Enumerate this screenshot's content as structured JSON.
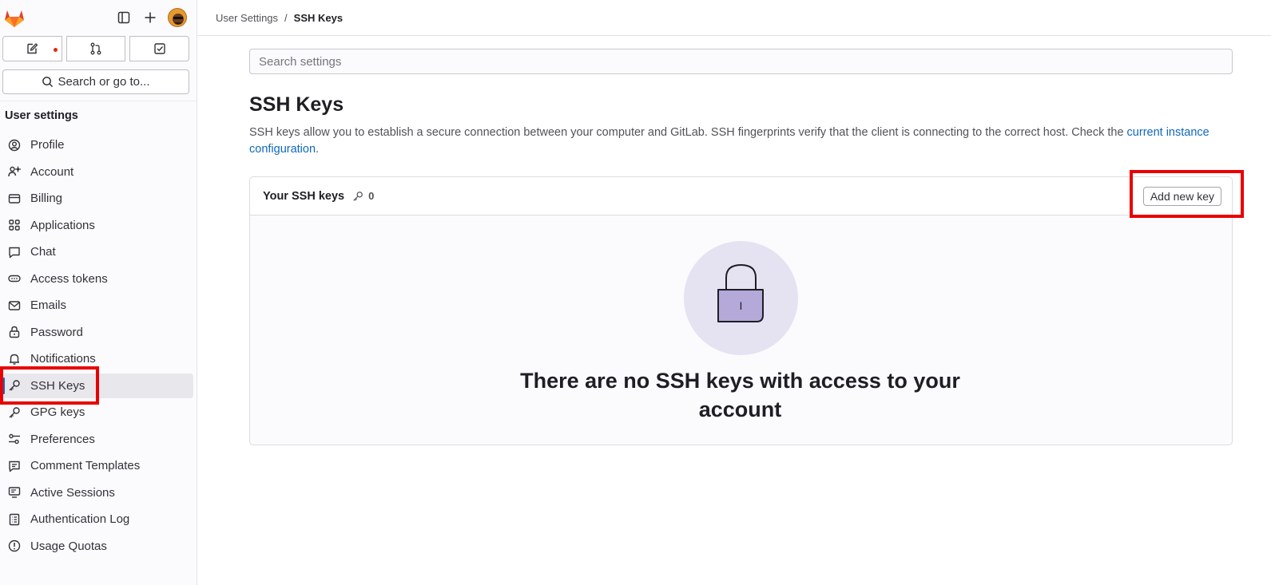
{
  "sidebar": {
    "section_title": "User settings",
    "search_label": "Search or go to...",
    "items": [
      {
        "label": "Profile",
        "icon": "profile-icon"
      },
      {
        "label": "Account",
        "icon": "account-icon"
      },
      {
        "label": "Billing",
        "icon": "billing-icon"
      },
      {
        "label": "Applications",
        "icon": "applications-icon"
      },
      {
        "label": "Chat",
        "icon": "chat-icon"
      },
      {
        "label": "Access tokens",
        "icon": "token-icon"
      },
      {
        "label": "Emails",
        "icon": "mail-icon"
      },
      {
        "label": "Password",
        "icon": "lock-icon"
      },
      {
        "label": "Notifications",
        "icon": "bell-icon"
      },
      {
        "label": "SSH Keys",
        "icon": "key-icon",
        "active": true
      },
      {
        "label": "GPG keys",
        "icon": "key-icon"
      },
      {
        "label": "Preferences",
        "icon": "preferences-icon"
      },
      {
        "label": "Comment Templates",
        "icon": "comment-icon"
      },
      {
        "label": "Active Sessions",
        "icon": "monitor-icon"
      },
      {
        "label": "Authentication Log",
        "icon": "log-icon"
      },
      {
        "label": "Usage Quotas",
        "icon": "quota-icon"
      }
    ]
  },
  "breadcrumb": {
    "parent": "User Settings",
    "separator": "/",
    "current": "SSH Keys"
  },
  "search": {
    "placeholder": "Search settings"
  },
  "page": {
    "title": "SSH Keys",
    "description": "SSH keys allow you to establish a secure connection between your computer and GitLab. SSH fingerprints verify that the client is connecting to the correct host. Check the ",
    "description_link": "current instance configuration",
    "description_end": "."
  },
  "card": {
    "title": "Your SSH keys",
    "count": "0",
    "add_button": "Add new key",
    "empty_message": "There are no SSH keys with access to your account",
    "empty_lock_label": "I"
  },
  "colors": {
    "accent": "#1068bf",
    "highlight": "#e90000",
    "lock_fill": "#b4a9d9",
    "illustration_bg": "#e5e2f2"
  }
}
